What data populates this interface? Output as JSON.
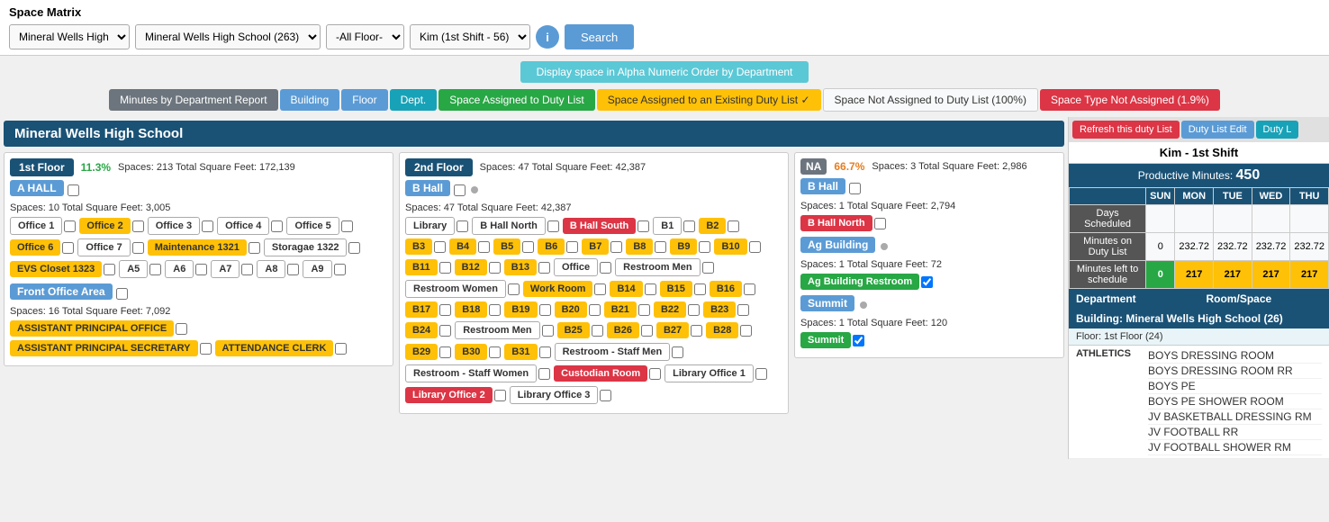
{
  "app": {
    "title": "Space Matrix"
  },
  "header": {
    "dropdowns": {
      "location": {
        "value": "Mineral Wells High",
        "options": [
          "Mineral Wells High"
        ]
      },
      "school": {
        "value": "Mineral Wells High School (263)",
        "options": [
          "Mineral Wells High School (263)"
        ]
      },
      "floor": {
        "value": "-All Floor-",
        "options": [
          "-All Floor-"
        ]
      },
      "person": {
        "value": "Kim (1st Shift - 56)",
        "options": [
          "Kim (1st Shift - 56)"
        ]
      }
    },
    "search_label": "Search",
    "alpha_btn": "Display space in Alpha Numeric Order by Department"
  },
  "tabs": [
    {
      "id": "dept-report",
      "label": "Minutes by Department Report",
      "class": "tab-dept-report"
    },
    {
      "id": "building",
      "label": "Building",
      "class": "tab-building"
    },
    {
      "id": "floor",
      "label": "Floor",
      "class": "tab-floor"
    },
    {
      "id": "dept",
      "label": "Dept.",
      "class": "tab-dept"
    },
    {
      "id": "space-assigned",
      "label": "Space Assigned to Duty List",
      "class": "tab-assigned"
    },
    {
      "id": "space-existing",
      "label": "Space Assigned to an Existing Duty List ✓",
      "class": "tab-existing"
    },
    {
      "id": "space-not-assigned",
      "label": "Space Not Assigned to Duty List (100%)",
      "class": "tab-not-assigned"
    },
    {
      "id": "space-type-not",
      "label": "Space Type Not Assigned (1.9%)",
      "class": "tab-type-not-assigned"
    }
  ],
  "school": {
    "name": "Mineral Wells High School",
    "floors": [
      {
        "id": "floor1",
        "badge": "1st Floor",
        "pct": "11.3%",
        "spaces_label": "Spaces: 213 Total Square Feet: 172,139",
        "halls": [
          {
            "name": "A HALL",
            "spaces_label": "Spaces: 10 Total Square Feet: 3,005",
            "spaces": [
              {
                "label": "Office 1",
                "style": "space-white"
              },
              {
                "label": "Office 2",
                "style": "space-yellow"
              },
              {
                "label": "Office 3",
                "style": "space-white"
              },
              {
                "label": "Office 4",
                "style": "space-white"
              },
              {
                "label": "Office 5",
                "style": "space-white"
              },
              {
                "label": "Office 6",
                "style": "space-yellow"
              },
              {
                "label": "Office 7",
                "style": "space-white"
              },
              {
                "label": "Maintenance 1321",
                "style": "space-yellow"
              },
              {
                "label": "Storagae 1322",
                "style": "space-white"
              },
              {
                "label": "EVS Closet 1323",
                "style": "space-yellow"
              },
              {
                "label": "A5",
                "style": "space-white"
              },
              {
                "label": "A6",
                "style": "space-white"
              },
              {
                "label": "A7",
                "style": "space-white"
              },
              {
                "label": "A8",
                "style": "space-white"
              },
              {
                "label": "A9",
                "style": "space-white"
              }
            ]
          },
          {
            "name": "Front Office Area",
            "spaces_label": "Spaces: 16 Total Square Feet: 7,092",
            "spaces": [
              {
                "label": "ASSISTANT PRINCIPAL OFFICE",
                "style": "space-yellow"
              },
              {
                "label": "ASSISTANT PRINCIPAL SECRETARY",
                "style": "space-yellow"
              },
              {
                "label": "ATTENDANCE CLERK",
                "style": "space-yellow"
              }
            ]
          }
        ]
      },
      {
        "id": "floor2",
        "badge": "2nd Floor",
        "pct": "",
        "spaces_label": "Spaces: 47 Total Square Feet: 42,387",
        "halls": [
          {
            "name": "B Hall",
            "spaces_label": "Spaces: 47 Total Square Feet: 42,387",
            "spaces": [
              {
                "label": "Library",
                "style": "space-white"
              },
              {
                "label": "B Hall North",
                "style": "space-white"
              },
              {
                "label": "B Hall South",
                "style": "space-red"
              },
              {
                "label": "B1",
                "style": "space-white"
              },
              {
                "label": "B2",
                "style": "space-yellow"
              },
              {
                "label": "B3",
                "style": "space-yellow"
              },
              {
                "label": "B4",
                "style": "space-yellow"
              },
              {
                "label": "B5",
                "style": "space-yellow"
              },
              {
                "label": "B6",
                "style": "space-yellow"
              },
              {
                "label": "B7",
                "style": "space-yellow"
              },
              {
                "label": "B8",
                "style": "space-yellow"
              },
              {
                "label": "B9",
                "style": "space-yellow"
              },
              {
                "label": "B10",
                "style": "space-yellow"
              },
              {
                "label": "B11",
                "style": "space-yellow"
              },
              {
                "label": "B12",
                "style": "space-yellow"
              },
              {
                "label": "B13",
                "style": "space-yellow"
              },
              {
                "label": "Office",
                "style": "space-white"
              },
              {
                "label": "Restroom Men",
                "style": "space-white"
              },
              {
                "label": "Restroom Women",
                "style": "space-white"
              },
              {
                "label": "Work Room",
                "style": "space-yellow"
              },
              {
                "label": "B14",
                "style": "space-yellow"
              },
              {
                "label": "B15",
                "style": "space-yellow"
              },
              {
                "label": "B16",
                "style": "space-yellow"
              },
              {
                "label": "B17",
                "style": "space-yellow"
              },
              {
                "label": "B18",
                "style": "space-yellow"
              },
              {
                "label": "B19",
                "style": "space-yellow"
              },
              {
                "label": "B20",
                "style": "space-yellow"
              },
              {
                "label": "B21",
                "style": "space-yellow"
              },
              {
                "label": "B22",
                "style": "space-yellow"
              },
              {
                "label": "B23",
                "style": "space-yellow"
              },
              {
                "label": "B24",
                "style": "space-yellow"
              },
              {
                "label": "Restroom Men",
                "style": "space-white"
              },
              {
                "label": "B25",
                "style": "space-yellow"
              },
              {
                "label": "B26",
                "style": "space-yellow"
              },
              {
                "label": "B27",
                "style": "space-yellow"
              },
              {
                "label": "B28",
                "style": "space-yellow"
              },
              {
                "label": "B29",
                "style": "space-yellow"
              },
              {
                "label": "B30",
                "style": "space-yellow"
              },
              {
                "label": "B31",
                "style": "space-yellow"
              },
              {
                "label": "Restroom - Staff Men",
                "style": "space-white"
              },
              {
                "label": "Restroom - Staff Women",
                "style": "space-white"
              },
              {
                "label": "Custodian Room",
                "style": "space-red"
              },
              {
                "label": "Library Office 1",
                "style": "space-white"
              },
              {
                "label": "Library Office 2",
                "style": "space-red"
              },
              {
                "label": "Library Office 3",
                "style": "space-white"
              }
            ]
          }
        ]
      },
      {
        "id": "floor-na",
        "badge": "NA",
        "pct": "66.7%",
        "pct_class": "pct-orange",
        "spaces_label": "Spaces: 3 Total Square Feet: 2,986",
        "halls": [
          {
            "name": "B Hall",
            "spaces_label": "Spaces: 1 Total Square Feet: 2,794",
            "spaces": [
              {
                "label": "B Hall North",
                "style": "space-red"
              }
            ]
          },
          {
            "name": "Ag Building",
            "spaces_label": "Spaces: 1 Total Square Feet: 72",
            "spaces": [
              {
                "label": "Ag Building Restroom",
                "style": "space-green"
              }
            ]
          },
          {
            "name": "Summit",
            "spaces_label": "Spaces: 1 Total Square Feet: 120",
            "spaces": [
              {
                "label": "Summit",
                "style": "space-green"
              }
            ]
          }
        ]
      }
    ]
  },
  "right_panel": {
    "refresh_btn": "Refresh this duty List",
    "duty_edit_btn": "Duty List Edit",
    "duty_btn": "Duty L",
    "user_label": "Kim - 1st Shift",
    "productive_label": "Productive Minutes:",
    "productive_value": "450",
    "schedule": {
      "headers": [
        "",
        "SUN",
        "MON",
        "TUE",
        "WED",
        "THU"
      ],
      "rows": [
        {
          "label": "Days Scheduled",
          "values": [
            "",
            "",
            "",
            "",
            ""
          ]
        },
        {
          "label": "Minutes on Duty List",
          "values": [
            "0",
            "232.72",
            "232.72",
            "232.72",
            "232.72"
          ]
        },
        {
          "label": "Minutes left to schedule",
          "values": [
            "0",
            "217",
            "217",
            "217",
            "217"
          ]
        }
      ]
    },
    "dept_label": "Department",
    "room_label": "Room/Space",
    "building_label": "Building: Mineral Wells High School (26)",
    "floor_label": "Floor: 1st Floor (24)",
    "departments": [
      {
        "name": "ATHLETICS",
        "rooms": [
          "BOYS DRESSING ROOM",
          "BOYS DRESSING ROOM RR",
          "BOYS PE",
          "BOYS PE SHOWER ROOM",
          "JV BASKETBALL DRESSING RM",
          "JV FOOTBALL RR",
          "JV FOOTBALL SHOWER RM"
        ]
      }
    ]
  }
}
